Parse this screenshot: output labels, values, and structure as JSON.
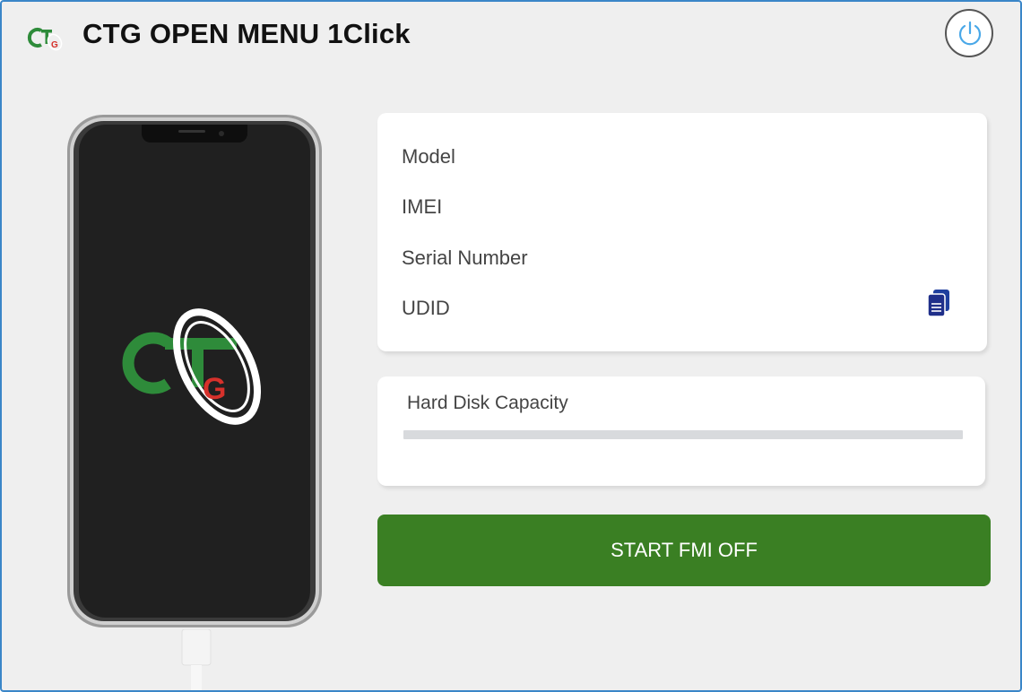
{
  "window": {
    "title": "CTG OPEN MENU 1Click",
    "power_icon": "power-icon",
    "accent_color": "#3a86c8"
  },
  "device_info": {
    "labels": [
      "Model",
      "IMEI",
      "Serial Number",
      "UDID"
    ],
    "copy_icon": "copy-icon"
  },
  "disk": {
    "label": "Hard Disk Capacity",
    "progress_percent": 0
  },
  "actions": {
    "start_label": "START FMI OFF",
    "start_color": "#3a7f23"
  }
}
